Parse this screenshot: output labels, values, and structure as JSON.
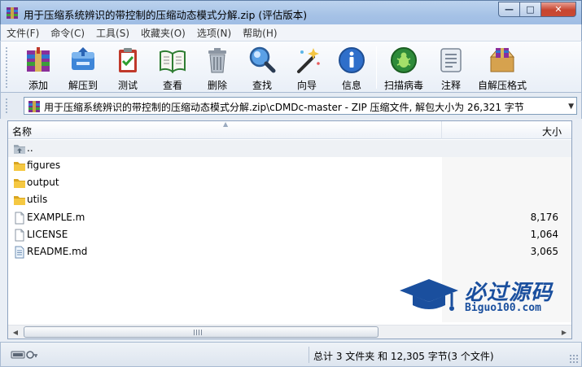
{
  "window": {
    "title": "用于压缩系统辨识的带控制的压缩动态模式分解.zip (评估版本)",
    "buttons": {
      "minimize": "—",
      "maximize": "□",
      "close": "✕"
    }
  },
  "menu": [
    {
      "label": "文件(F)"
    },
    {
      "label": "命令(C)"
    },
    {
      "label": "工具(S)"
    },
    {
      "label": "收藏夹(O)"
    },
    {
      "label": "选项(N)"
    },
    {
      "label": "帮助(H)"
    }
  ],
  "toolbar": [
    {
      "label": "添加",
      "icon": "add-archive-icon"
    },
    {
      "label": "解压到",
      "icon": "extract-to-icon"
    },
    {
      "label": "测试",
      "icon": "test-icon"
    },
    {
      "label": "查看",
      "icon": "view-book-icon"
    },
    {
      "label": "删除",
      "icon": "trash-icon"
    },
    {
      "label": "查找",
      "icon": "magnifier-icon"
    },
    {
      "label": "向导",
      "icon": "wizard-wand-icon"
    },
    {
      "label": "信息",
      "icon": "info-icon"
    },
    {
      "label": "扫描病毒",
      "icon": "virus-scan-icon"
    },
    {
      "label": "注释",
      "icon": "comment-icon"
    },
    {
      "label": "自解压格式",
      "icon": "sfx-box-icon"
    }
  ],
  "address": {
    "path": "用于压缩系统辨识的带控制的压缩动态模式分解.zip\\cDMDc-master - ZIP 压缩文件, 解包大小为 26,321 字节"
  },
  "list": {
    "columns": {
      "name": "名称",
      "size": "大小"
    },
    "rows": [
      {
        "name": "..",
        "size": "",
        "type": "up"
      },
      {
        "name": "figures",
        "size": "",
        "type": "folder"
      },
      {
        "name": "output",
        "size": "",
        "type": "folder"
      },
      {
        "name": "utils",
        "size": "",
        "type": "folder"
      },
      {
        "name": "EXAMPLE.m",
        "size": "8,176",
        "type": "file"
      },
      {
        "name": "LICENSE",
        "size": "1,064",
        "type": "file"
      },
      {
        "name": "README.md",
        "size": "3,065",
        "type": "file"
      }
    ]
  },
  "watermark": {
    "title": "必过源码",
    "site": "Biguo100.com"
  },
  "status": {
    "summary": "总计 3 文件夹 和 12,305 字节(3 个文件)"
  }
}
